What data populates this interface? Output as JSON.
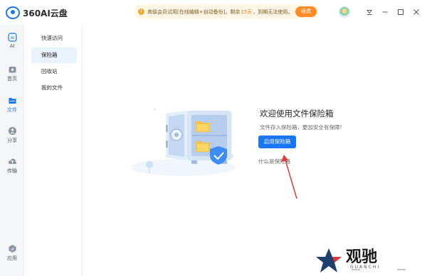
{
  "app": {
    "logo_text": "360AI云盘",
    "notice": {
      "prefix": "商级会员试用[在线编辑+自动备份]，剩余",
      "days": "15天",
      "suffix": "，到期无法使用。",
      "button": "续费"
    }
  },
  "rail": {
    "items": [
      {
        "label": "AI",
        "icon": "ai-icon"
      },
      {
        "label": "首页",
        "icon": "home-icon"
      },
      {
        "label": "文件",
        "icon": "folder-icon"
      },
      {
        "label": "分享",
        "icon": "share-icon"
      },
      {
        "label": "传输",
        "icon": "transfer-icon"
      },
      {
        "label": "应用",
        "icon": "apps-icon"
      }
    ],
    "active_color": "#1976f5"
  },
  "subnav": {
    "items": [
      {
        "label": "快速访问"
      },
      {
        "label": "保险箱"
      },
      {
        "label": "回收站"
      },
      {
        "label": "我的文件"
      }
    ]
  },
  "main": {
    "welcome_title": "欢迎使用文件保险箱",
    "welcome_sub": "文件存入保险箱，更加安全有保障!",
    "enable_button": "启用保险箱",
    "what_link": "什么是保险箱"
  },
  "watermark": {
    "text": "观驰",
    "sub": "GUANCHI"
  },
  "colors": {
    "accent": "#1976f5",
    "notice_bg": "#fff6e6",
    "notice_button": "#ff8a26",
    "arrow": "#e53935"
  }
}
